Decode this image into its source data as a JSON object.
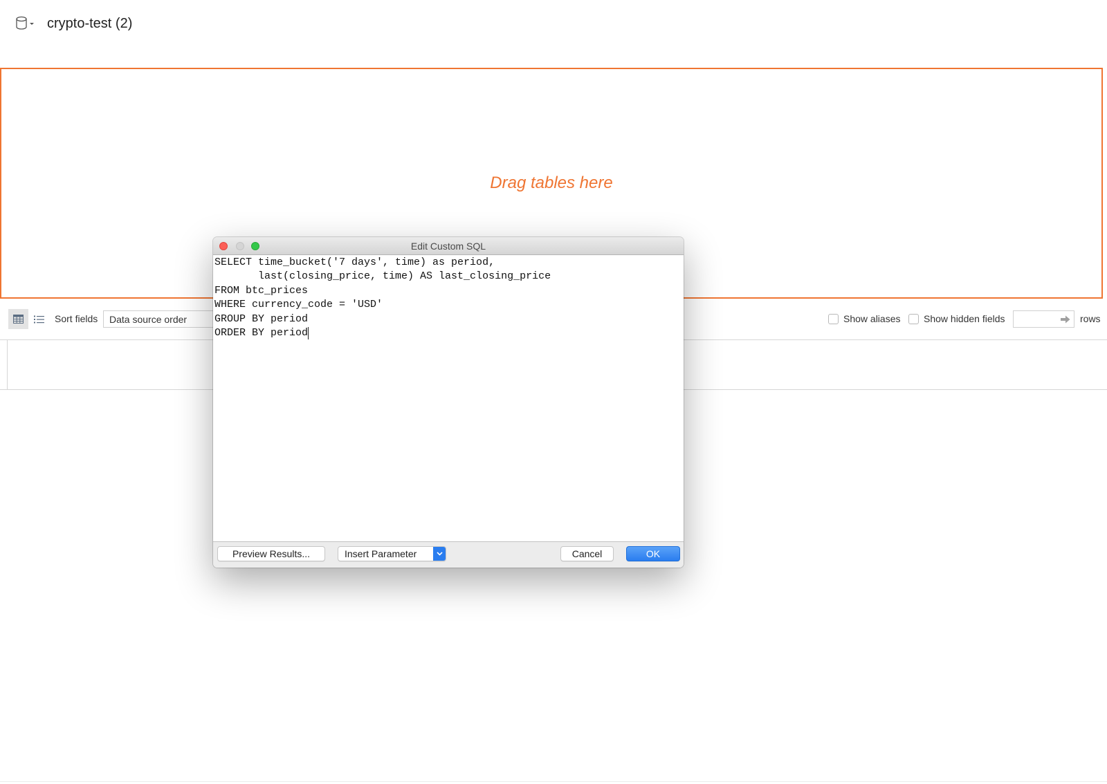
{
  "datasource": {
    "icon": "database-icon",
    "name": "crypto-test (2)"
  },
  "canvas": {
    "placeholder": "Drag tables here"
  },
  "toolbar": {
    "view_mode": "grid",
    "view_icons": {
      "grid": "grid-icon",
      "list": "list-icon"
    },
    "sort_label": "Sort fields",
    "sort_value": "Data source order",
    "show_aliases": {
      "label": "Show aliases",
      "checked": false
    },
    "show_hidden_fields": {
      "label": "Show hidden fields",
      "checked": false
    },
    "rows_input": {
      "value": "",
      "icon": "arrow-right-icon"
    },
    "rows_label": "rows"
  },
  "dialog": {
    "title": "Edit Custom SQL",
    "window_controls": [
      "close",
      "minimize",
      "zoom"
    ],
    "sql": "SELECT time_bucket('7 days', time) as period,\n       last(closing_price, time) AS last_closing_price\nFROM btc_prices\nWHERE currency_code = 'USD'\nGROUP BY period\nORDER BY period",
    "buttons": {
      "preview": "Preview Results...",
      "insert_parameter": "Insert Parameter",
      "cancel": "Cancel",
      "ok": "OK"
    }
  },
  "colors": {
    "accent": "#ef7532",
    "primary_button": "#2a7def",
    "close_light": "#fc5f57",
    "minimize_light": "#d5d5d5",
    "zoom_light": "#34c84a"
  }
}
